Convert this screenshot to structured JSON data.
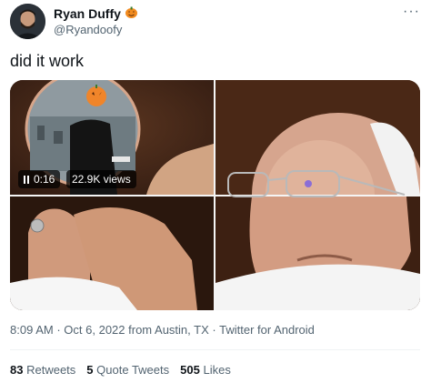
{
  "tweet": {
    "author_name": "Ryan Duffy",
    "name_emoji": "🎃",
    "handle": "@Ryandoofy",
    "more_label": "···",
    "text": "did it work",
    "video_time": "0:16",
    "video_views": "22.9K views",
    "time": "8:09 AM",
    "date": "Oct 6, 2022",
    "location": "from Austin, TX",
    "source": "Twitter for Android",
    "dot": "·",
    "retweets": "83",
    "retweets_label": "Retweets",
    "quotes": "5",
    "quotes_label": "Quote Tweets",
    "likes": "505",
    "likes_label": "Likes"
  },
  "colors": {
    "text_primary": "#0f1419",
    "text_secondary": "#536471",
    "divider": "#eff3f4"
  }
}
